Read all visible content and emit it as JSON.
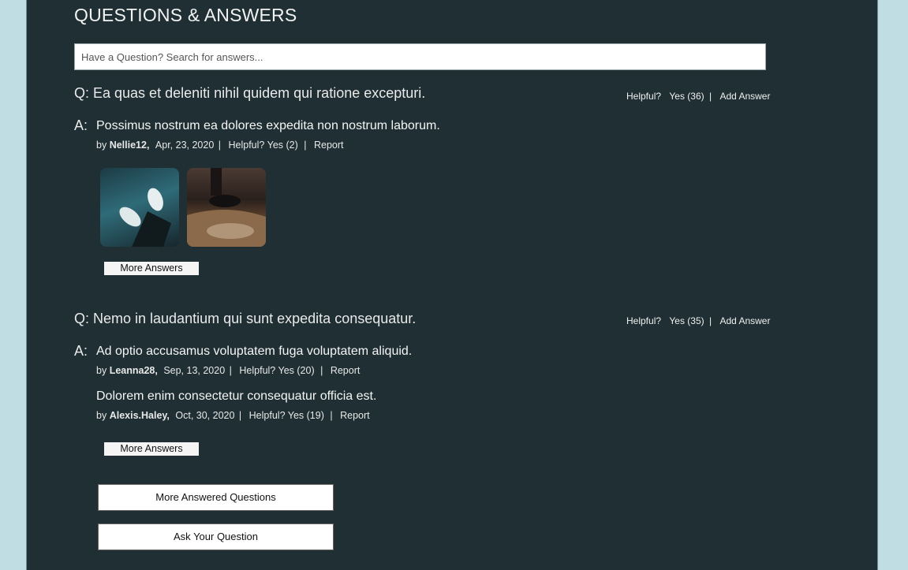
{
  "header": {
    "title": "QUESTIONS & ANSWERS"
  },
  "search": {
    "placeholder": "Have a Question? Search for answers..."
  },
  "questions": [
    {
      "text": "Q: Ea quas et deleniti nihil quidem qui ratione excepturi.",
      "helpful_label": "Helpful?",
      "yes_label": "Yes (36)",
      "separator": "|",
      "add_answer_label": "Add Answer",
      "answer_prefix": "A:",
      "answers": [
        {
          "body": "Possimus nostrum ea dolores expedita non nostrum laborum.",
          "by": "by",
          "user": "Nellie12,",
          "date": "Apr, 23, 2020",
          "sep1": "|",
          "helpful": "Helpful?",
          "yes": "Yes (2)",
          "sep2": "|",
          "report": "Report"
        }
      ],
      "more_answers_label": "More Answers"
    },
    {
      "text": "Q: Nemo in laudantium qui sunt expedita consequatur.",
      "helpful_label": "Helpful?",
      "yes_label": "Yes (35)",
      "separator": "|",
      "add_answer_label": "Add Answer",
      "answer_prefix": "A:",
      "answers": [
        {
          "body": "Ad optio accusamus voluptatem fuga voluptatem aliquid.",
          "by": "by",
          "user": "Leanna28,",
          "date": "Sep, 13, 2020",
          "sep1": "|",
          "helpful": "Helpful?",
          "yes": "Yes (20)",
          "sep2": "|",
          "report": "Report"
        },
        {
          "body": "Dolorem enim consectetur consequatur officia est.",
          "by": "by",
          "user": "Alexis.Haley,",
          "date": "Oct, 30, 2020",
          "sep1": "|",
          "helpful": "Helpful?",
          "yes": "Yes (19)",
          "sep2": "|",
          "report": "Report"
        }
      ],
      "more_answers_label": "More Answers"
    }
  ],
  "footer": {
    "more_questions_label": "More Answered Questions",
    "ask_question_label": "Ask Your Question"
  },
  "colors": {
    "page_bg": "#bfdde2",
    "panel_bg": "#1f2f33",
    "text": "#ffffff"
  }
}
